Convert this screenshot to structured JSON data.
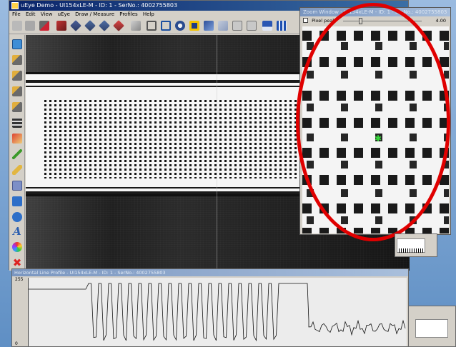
{
  "main_window": {
    "title": "uEye Demo - UI154xLE-M - ID: 1 - SerNo.: 4002755803",
    "menu": [
      "File",
      "Edit",
      "View",
      "uEye",
      "Draw / Measure",
      "Profiles",
      "Help"
    ]
  },
  "zoom_window": {
    "title": "Zoom Window - UI154xLE-M - ID: 1 - SerNo.: 4002755803",
    "pixel_peak_label": "Pixel peak",
    "zoom_value": "4.00"
  },
  "profile_window": {
    "title": "Horizontal Line Profile - UI154xLE-M - ID: 1 - SerNo.: 4002755803",
    "y_max_label": "255",
    "y_min_label": "0"
  },
  "icons": {
    "toolbar": [
      "open-icon",
      "save-icon",
      "color-mode-icon",
      "sensor-icon",
      "sensor-icon",
      "sensor-icon",
      "sensor-icon",
      "measure-icon",
      "rectangle-icon",
      "select-icon",
      "record-icon",
      "stop-icon",
      "image-icon",
      "image-icon",
      "image-icon",
      "image-icon",
      "save-disk-icon",
      "grid-icon"
    ],
    "left": [
      "fit-icon",
      "ruler-icon",
      "ruler-icon",
      "ruler-icon",
      "ruler-icon",
      "grid-icon",
      "color-icon",
      "pencil-icon",
      "marker-icon",
      "fill-icon",
      "rectangle-icon",
      "ellipse-icon",
      "text-icon",
      "palette-icon",
      "delete-icon",
      "view-icon"
    ]
  },
  "colors": {
    "annotation": "#e00000",
    "crosshair": "#36d63a",
    "title_active": "#0a246a"
  }
}
